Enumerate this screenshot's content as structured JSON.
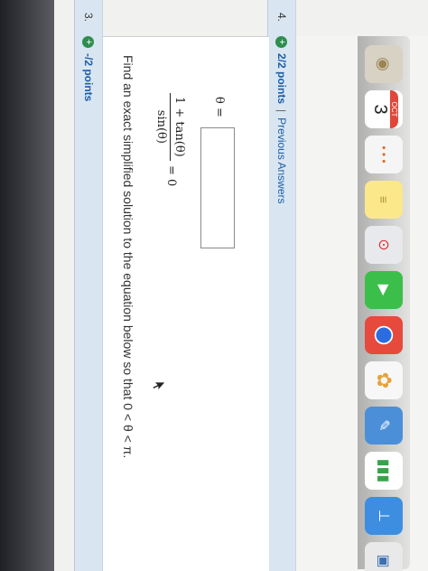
{
  "question3": {
    "number": "3.",
    "points": "-/2 points",
    "prompt": "Find an exact simplified solution to the equation below so that 0 < θ < π.",
    "numerator": "1 + tan(θ)",
    "denominator": "sin(θ)",
    "equals_zero": "= 0",
    "theta_label": "θ =",
    "answer_value": ""
  },
  "question4": {
    "number": "4.",
    "points": "2/2 points",
    "separator": "|",
    "previous_answers": "Previous Answers"
  },
  "dock": {
    "calendar_month": "OCT",
    "calendar_day": "3"
  },
  "colors": {
    "header_bg": "#d9e6f1",
    "points_blue": "#1d5ea8",
    "plus_green": "#2d8e4e"
  }
}
